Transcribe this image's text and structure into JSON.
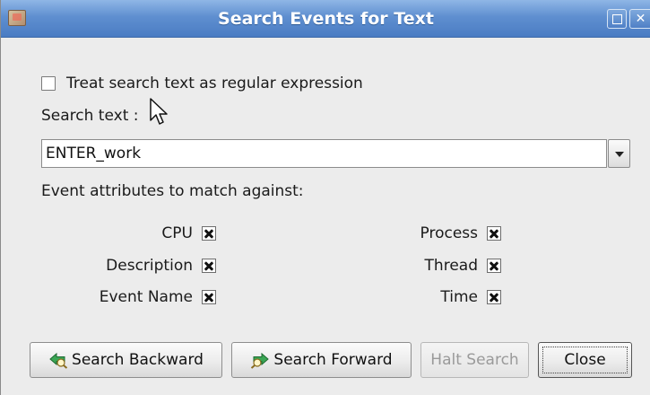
{
  "window": {
    "title": "Search Events for Text"
  },
  "options": {
    "regex_label": "Treat search text as regular expression",
    "regex_checked": false
  },
  "search": {
    "label": "Search text :",
    "value": "ENTER_work"
  },
  "attributes": {
    "heading": "Event attributes to match against:",
    "left": [
      {
        "label": "CPU",
        "checked": true
      },
      {
        "label": "Description",
        "checked": true
      },
      {
        "label": "Event Name",
        "checked": true
      }
    ],
    "right": [
      {
        "label": "Process",
        "checked": true
      },
      {
        "label": "Thread",
        "checked": true
      },
      {
        "label": "Time",
        "checked": true
      }
    ]
  },
  "buttons": {
    "search_backward": "Search Backward",
    "search_forward": "Search Forward",
    "halt_search": "Halt Search",
    "close": "Close"
  },
  "icons": {
    "window": "app-icon",
    "search_backward": "search-backward-icon",
    "search_forward": "search-forward-icon"
  },
  "colors": {
    "titlebar": "#5f8fd0",
    "background": "#ececec"
  }
}
